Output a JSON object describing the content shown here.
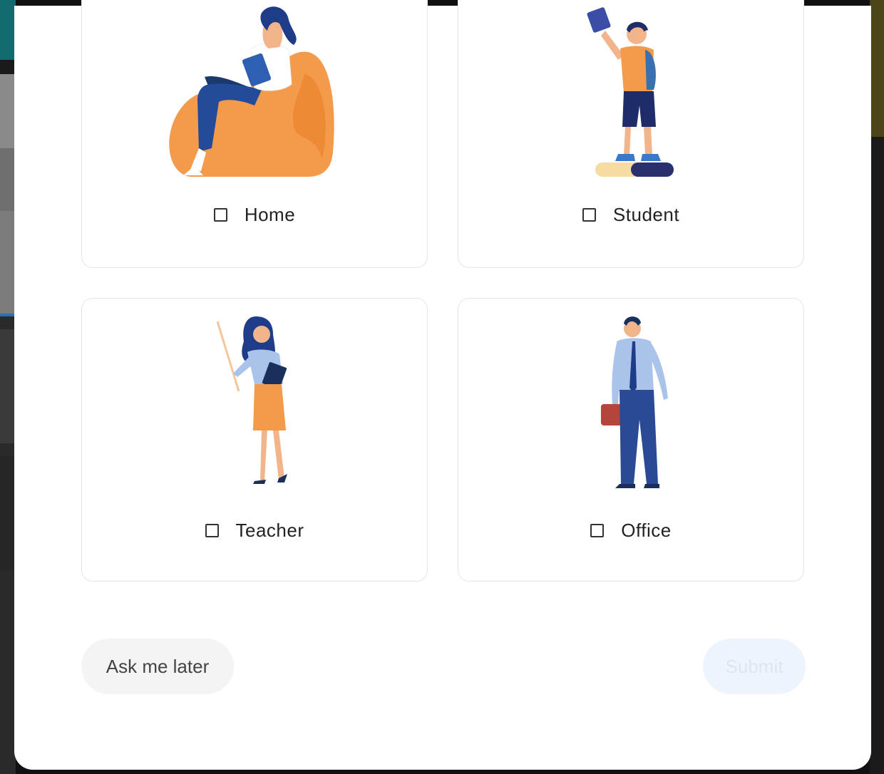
{
  "options": [
    {
      "label": "Home",
      "icon": "woman-reading-on-beanbag-illustration",
      "checked": false
    },
    {
      "label": "Student",
      "icon": "student-on-books-illustration",
      "checked": false
    },
    {
      "label": "Teacher",
      "icon": "teacher-with-pointer-illustration",
      "checked": false
    },
    {
      "label": "Office",
      "icon": "office-worker-with-briefcase-illustration",
      "checked": false
    }
  ],
  "actions": {
    "later_label": "Ask me later",
    "submit_label": "Submit"
  },
  "colors": {
    "accent_orange": "#f49a4b",
    "navy": "#1e3a7b",
    "submit_disabled_bg": "#eef4fb",
    "later_bg": "#f4f4f4"
  }
}
